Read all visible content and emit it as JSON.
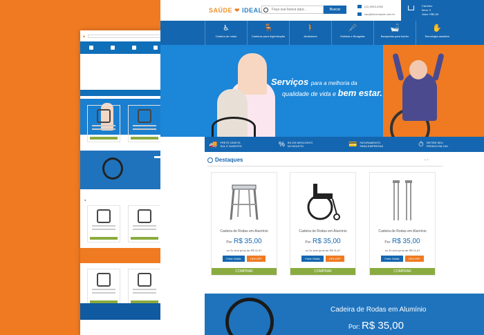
{
  "header": {
    "brand_a": "SAÚDE",
    "brand_b": "IDEAL",
    "search_placeholder": "Faça sua busca aqui...",
    "search_button": "Buscar",
    "phone": "(11) 5063-4060",
    "email": "sac@ideal.saude.com.br",
    "cart_title": "Carrinho",
    "cart_items": "Itens: 0",
    "cart_value": "Valor: R$0,00"
  },
  "categories": [
    {
      "icon": "♿",
      "label": "Cadeira de rodas"
    },
    {
      "icon": "🪑",
      "label": "Cadeiras para higienização"
    },
    {
      "icon": "🚶",
      "label": "Andadores"
    },
    {
      "icon": "🩼",
      "label": "Muletas e Bengalas"
    },
    {
      "icon": "🛁",
      "label": "Banquetas para banho"
    },
    {
      "icon": "✋",
      "label": "Tecnologia assistiva"
    }
  ],
  "hero": {
    "line1": "Serviços",
    "line1b": "para a melhoria da",
    "line2": "qualidade de vida e",
    "line2b": "bem estar."
  },
  "benefits": [
    {
      "icon": "🚚",
      "line1": "FRETE GRÁTIS",
      "line2": "SUL E SUDESTE"
    },
    {
      "icon": "%",
      "line1": "5% DE DESCONTO",
      "line2": "NO BOLETO"
    },
    {
      "icon": "💳",
      "line1": "FATURAMENTO",
      "line2": "PARA EMPRESAS"
    },
    {
      "icon": "⏱",
      "line1": "RETIRE SEU",
      "line2": "PEDIDO EM 24H"
    }
  ],
  "destaques": {
    "title": "Destaques",
    "arrows": "‹ ›"
  },
  "products": [
    {
      "name": "Cadeira de Rodas em Alumínio",
      "price_label": "Por:",
      "price": "R$ 35,00",
      "installments": "ou 3x sem juros de R$ 11,67",
      "tag1": "Frete Grátis",
      "tag2": "15% OFF",
      "buy": "COMPRAR",
      "icon": "walker"
    },
    {
      "name": "Cadeira de Rodas em Alumínio",
      "price_label": "Por:",
      "price": "R$ 35,00",
      "installments": "ou 3x sem juros de R$ 11,67",
      "tag1": "Frete Grátis",
      "tag2": "15% OFF",
      "buy": "COMPRAR",
      "icon": "wheelchair"
    },
    {
      "name": "Cadeira de Rodas em Alumínio",
      "price_label": "Por:",
      "price": "R$ 35,00",
      "installments": "ou 3x sem juros de R$ 11,67",
      "tag1": "Frete Grátis",
      "tag2": "15% OFF",
      "buy": "COMPRAR",
      "icon": "crutches"
    }
  ],
  "promo": {
    "title": "Cadeira de Rodas em Alumínio",
    "price_label": "Por:",
    "price": "R$ 35,00"
  }
}
